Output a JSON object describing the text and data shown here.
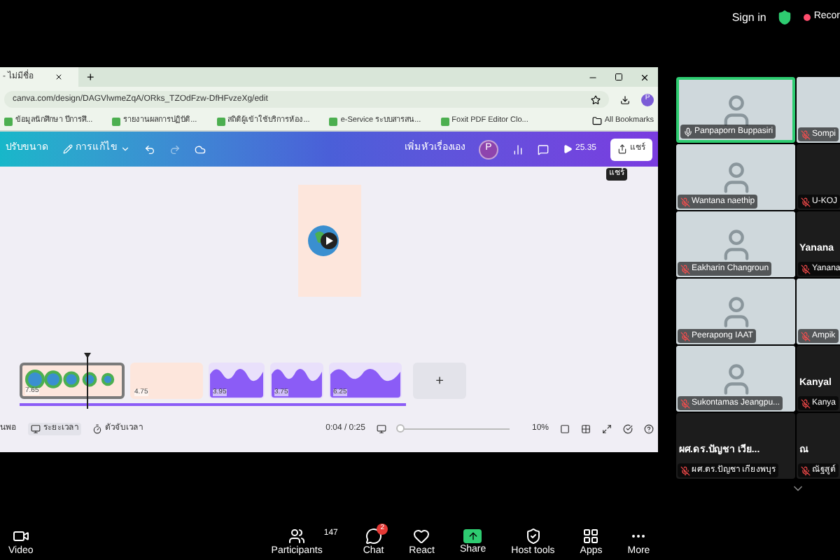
{
  "top_bar": {
    "sign_in": "Sign in",
    "recording": "Recor"
  },
  "browser": {
    "tab_title": "- ไม่มีชื่อ",
    "new_tab": "+",
    "url": "canva.com/design/DAGVlwmeZqA/ORks_TZOdFzw-DfHFvzeXg/edit",
    "avatar": "P",
    "bookmarks": [
      {
        "label": "ข้อมูลนักศึกษา ปีการศึ..."
      },
      {
        "label": "รายงานผลการปฏิบัติ..."
      },
      {
        "label": "สถิติผู้เข้าใช้บริการห้อง..."
      },
      {
        "label": "e-Service ระบบสารสน..."
      },
      {
        "label": "Foxit PDF Editor Clo..."
      }
    ],
    "all_bookmarks": "All Bookmarks"
  },
  "canva_toolbar": {
    "resize": "ปรับขนาด",
    "edit_menu": "การแก้ไข",
    "title": "เพิ่มหัวเรื่องเอง",
    "avatar": "P",
    "play_time": "25.35",
    "share": "แชร์",
    "tooltip": "แชร์"
  },
  "timeline": {
    "clips": [
      {
        "kind": "globe",
        "duration": "7.65",
        "selected": true
      },
      {
        "kind": "blank",
        "duration": "4.75",
        "selected": false
      },
      {
        "kind": "wave",
        "duration": "3.95",
        "selected": false
      },
      {
        "kind": "wave",
        "duration": "3.75",
        "selected": false
      },
      {
        "kind": "wave",
        "duration": "6.25",
        "selected": false
      }
    ],
    "add": "+"
  },
  "bottom_bar": {
    "notes": "นพอ",
    "duration": "ระยะเวลา",
    "timer": "ตัวจับเวลา",
    "time": "0:04 / 0:25",
    "zoom": {
      "level": 0.03
    },
    "zoom_label": "10%"
  },
  "participant_rows": [
    {
      "tiles": [
        {
          "kind": "video",
          "name": "Panpaporn Buppasiri",
          "muted": false,
          "speaking": true
        },
        {
          "kind": "video",
          "name": "Sompi",
          "muted": true,
          "speaking": false
        }
      ]
    },
    {
      "tiles": [
        {
          "kind": "video",
          "name": "Wantana naethip",
          "muted": true,
          "speaking": false
        },
        {
          "kind": "name",
          "name": "U-KOJ",
          "muted": true,
          "speaking": false
        }
      ]
    },
    {
      "tiles": [
        {
          "kind": "video",
          "name": "Eakharin Changroun",
          "muted": true,
          "speaking": false
        },
        {
          "kind": "name",
          "heading": "Yanana",
          "name": "Yanana",
          "muted": true,
          "speaking": false
        }
      ]
    },
    {
      "tiles": [
        {
          "kind": "video",
          "name": "Peerapong IAAT",
          "muted": true,
          "speaking": false
        },
        {
          "kind": "video",
          "name": "Ampik",
          "muted": true,
          "speaking": false
        }
      ]
    },
    {
      "tiles": [
        {
          "kind": "video",
          "name": "Sukontamas Jeangpu...",
          "muted": true,
          "speaking": false
        },
        {
          "kind": "name",
          "heading": "Kanyal",
          "name": "Kanya",
          "muted": true,
          "speaking": false
        }
      ]
    },
    {
      "tiles": [
        {
          "kind": "name",
          "heading": "ผศ.ดร.ปัญชา เวีย...",
          "name": "ผศ.ดร.ปัญชา เกียงพบุร",
          "muted": true,
          "speaking": false
        },
        {
          "kind": "name",
          "heading": "ณ",
          "name": "ณัฐสูต์",
          "muted": true,
          "speaking": false
        }
      ]
    }
  ],
  "toolbar": [
    {
      "kind": "video",
      "label": "Video"
    },
    {
      "kind": "participants",
      "label": "Participants",
      "count": "147"
    },
    {
      "kind": "chat",
      "label": "Chat",
      "badge": "2"
    },
    {
      "kind": "react",
      "label": "React"
    },
    {
      "kind": "share",
      "label": "Share"
    },
    {
      "kind": "host",
      "label": "Host tools"
    },
    {
      "kind": "apps",
      "label": "Apps"
    },
    {
      "kind": "more",
      "label": "More"
    }
  ]
}
